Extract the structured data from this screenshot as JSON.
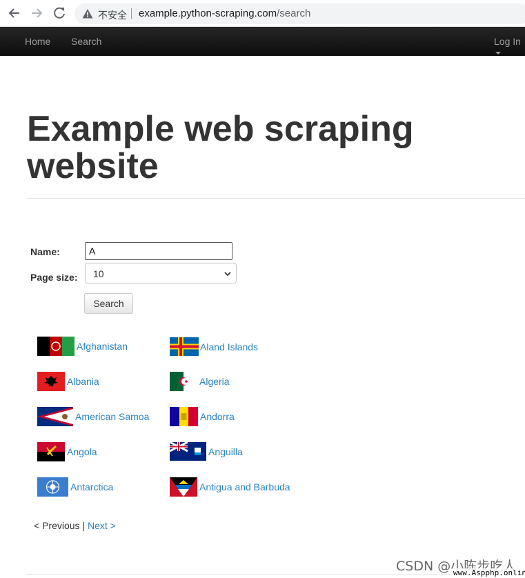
{
  "browser": {
    "security_label": "不安全",
    "url_host": "example.python-scraping.com",
    "url_path": "/search"
  },
  "navbar": {
    "home": "Home",
    "search": "Search",
    "login": "Log In"
  },
  "page_title": "Example web scraping website",
  "form": {
    "name_label": "Name:",
    "name_value": "A",
    "page_size_label": "Page size:",
    "page_size_value": "10",
    "search_button": "Search"
  },
  "countries": [
    "Afghanistan",
    "Aland Islands",
    "Albania",
    "Algeria",
    "American Samoa",
    "Andorra",
    "Angola",
    "Anguilla",
    "Antarctica",
    "Antigua and Barbuda"
  ],
  "pager": {
    "previous": "< Previous",
    "separator": "|",
    "next": "Next >"
  },
  "watermark": "CSDN @小陈步吃人",
  "watermark_site": "www.Aspphp.online",
  "colors": {
    "link": "#2a83c0",
    "navbar": "#1b1b1b"
  }
}
